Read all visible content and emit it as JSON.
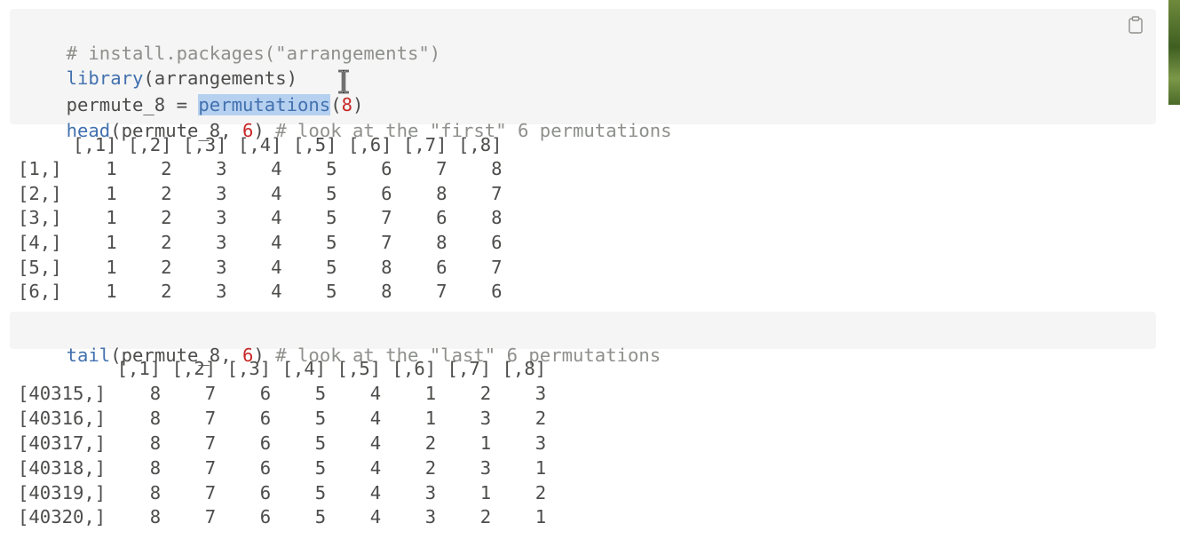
{
  "chunk1": {
    "line1_comment": "# install.packages(\"arrangements\")",
    "line2_fn": "library",
    "line2_rest": "(arrangements)",
    "line3_lhs": "permute_8 = ",
    "line3_fn": "permutations",
    "line3_open": "(",
    "line3_num": "8",
    "line3_close": ")",
    "line4_fn": "head",
    "line4_args": "(permute_8, ",
    "line4_num": "6",
    "line4_close": ") ",
    "line4_comment": "# look at the \"first\" 6 permutations",
    "copy_icon": "clipboard-icon"
  },
  "output1": {
    "header": "     [,1] [,2] [,3] [,4] [,5] [,6] [,7] [,8]",
    "rows": [
      "[1,]    1    2    3    4    5    6    7    8",
      "[2,]    1    2    3    4    5    6    8    7",
      "[3,]    1    2    3    4    5    7    6    8",
      "[4,]    1    2    3    4    5    7    8    6",
      "[5,]    1    2    3    4    5    8    6    7",
      "[6,]    1    2    3    4    5    8    7    6"
    ]
  },
  "chunk2": {
    "fn": "tail",
    "args": "(permute_8, ",
    "num": "6",
    "close": ") ",
    "comment": "# look at the \"last\" 6 permutations"
  },
  "output2": {
    "header": "         [,1] [,2] [,3] [,4] [,5] [,6] [,7] [,8]",
    "rows": [
      "[40315,]    8    7    6    5    4    1    2    3",
      "[40316,]    8    7    6    5    4    1    3    2",
      "[40317,]    8    7    6    5    4    2    1    3",
      "[40318,]    8    7    6    5    4    2    3    1",
      "[40319,]    8    7    6    5    4    3    1    2",
      "[40320,]    8    7    6    5    4    3    2    1"
    ]
  },
  "colors": {
    "chunk_bg": "#f5f5f5",
    "function": "#4271ae",
    "number": "#c82829",
    "comment": "#8e908c",
    "selection": "#b6d0f0"
  }
}
